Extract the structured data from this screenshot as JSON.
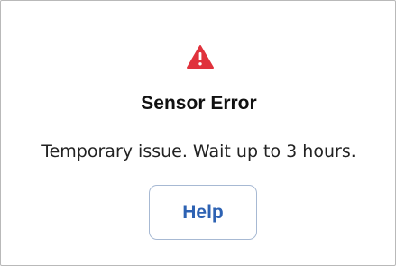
{
  "dialog": {
    "icon": "warning-triangle-icon",
    "icon_color": "#e0323c",
    "title": "Sensor Error",
    "message": "Temporary issue. Wait up to 3 hours.",
    "help_button_label": "Help",
    "accent_color": "#2d62b3"
  }
}
